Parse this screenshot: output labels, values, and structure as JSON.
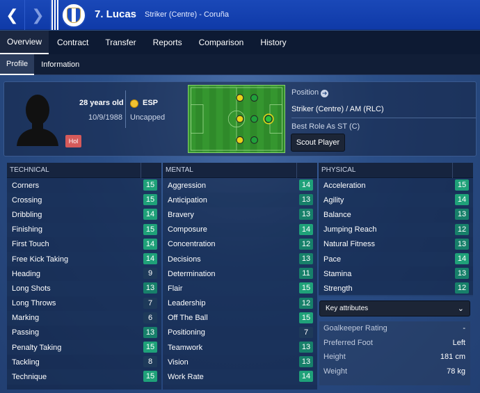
{
  "header": {
    "player_name": "7. Lucas",
    "player_sub": "Striker (Centre) - Coruña",
    "back_icon": "chevron-left-icon",
    "forward_icon": "chevron-right-icon"
  },
  "tabs": [
    "Overview",
    "Contract",
    "Transfer",
    "Reports",
    "Comparison",
    "History"
  ],
  "subtabs": [
    "Profile",
    "Information"
  ],
  "profile": {
    "age": "28 years old",
    "dob": "10/9/1988",
    "nation": "ESP",
    "caps": "Uncapped",
    "badge": "Hol",
    "position_label": "Position",
    "position_value": "Striker (Centre) / AM (RLC)",
    "best_role": "Best Role As ST (C)",
    "scout_button": "Scout Player"
  },
  "technical": {
    "title": "TECHNICAL",
    "rows": [
      {
        "name": "Corners",
        "value": "15"
      },
      {
        "name": "Crossing",
        "value": "15"
      },
      {
        "name": "Dribbling",
        "value": "14"
      },
      {
        "name": "Finishing",
        "value": "15"
      },
      {
        "name": "First Touch",
        "value": "14"
      },
      {
        "name": "Free Kick Taking",
        "value": "14"
      },
      {
        "name": "Heading",
        "value": "9"
      },
      {
        "name": "Long Shots",
        "value": "13"
      },
      {
        "name": "Long Throws",
        "value": "7"
      },
      {
        "name": "Marking",
        "value": "6"
      },
      {
        "name": "Passing",
        "value": "13"
      },
      {
        "name": "Penalty Taking",
        "value": "15"
      },
      {
        "name": "Tackling",
        "value": "8"
      },
      {
        "name": "Technique",
        "value": "15"
      }
    ]
  },
  "mental": {
    "title": "MENTAL",
    "rows": [
      {
        "name": "Aggression",
        "value": "14"
      },
      {
        "name": "Anticipation",
        "value": "13"
      },
      {
        "name": "Bravery",
        "value": "13"
      },
      {
        "name": "Composure",
        "value": "14"
      },
      {
        "name": "Concentration",
        "value": "12"
      },
      {
        "name": "Decisions",
        "value": "13"
      },
      {
        "name": "Determination",
        "value": "11"
      },
      {
        "name": "Flair",
        "value": "15"
      },
      {
        "name": "Leadership",
        "value": "12"
      },
      {
        "name": "Off The Ball",
        "value": "15"
      },
      {
        "name": "Positioning",
        "value": "7"
      },
      {
        "name": "Teamwork",
        "value": "13"
      },
      {
        "name": "Vision",
        "value": "13"
      },
      {
        "name": "Work Rate",
        "value": "14"
      }
    ]
  },
  "physical": {
    "title": "PHYSICAL",
    "rows": [
      {
        "name": "Acceleration",
        "value": "15"
      },
      {
        "name": "Agility",
        "value": "14"
      },
      {
        "name": "Balance",
        "value": "13"
      },
      {
        "name": "Jumping Reach",
        "value": "12"
      },
      {
        "name": "Natural Fitness",
        "value": "13"
      },
      {
        "name": "Pace",
        "value": "14"
      },
      {
        "name": "Stamina",
        "value": "13"
      },
      {
        "name": "Strength",
        "value": "12"
      }
    ]
  },
  "key_attributes_label": "Key attributes",
  "misc": [
    {
      "name": "Goalkeeper Rating",
      "value": "-"
    },
    {
      "name": "Preferred Foot",
      "value": "Left"
    },
    {
      "name": "Height",
      "value": "181 cm"
    },
    {
      "name": "Weight",
      "value": "78 kg"
    }
  ]
}
